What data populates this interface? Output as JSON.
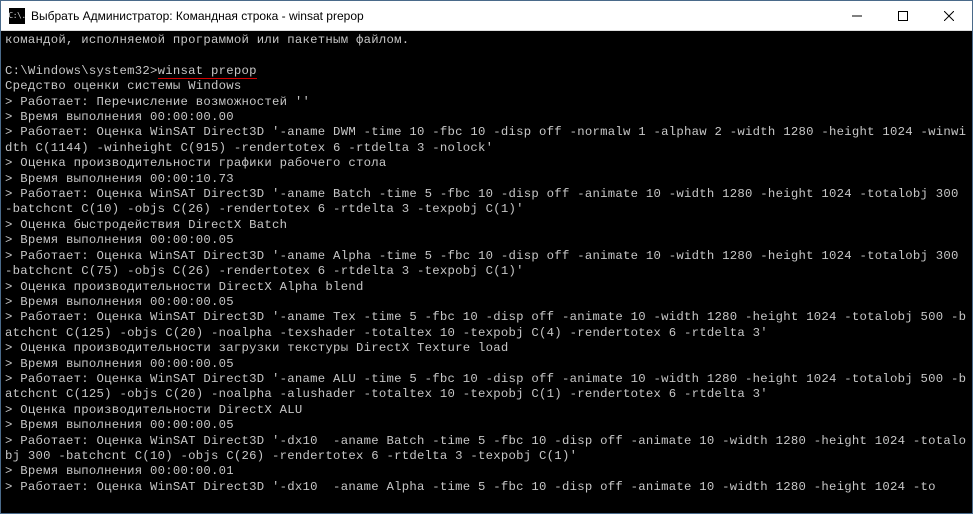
{
  "title": "Выбрать Администратор: Командная строка - winsat  prepop",
  "app_icon_glyph": "C:\\.",
  "prompt_path": "C:\\Windows\\system32>",
  "command": "winsat prepop",
  "lines_before": [
    "командой, исполняемой программой или пакетным файлом.",
    ""
  ],
  "lines_after": [
    "Средство оценки системы Windows",
    "> Работает: Перечисление возможностей ''",
    "> Время выполнения 00:00:00.00",
    "> Работает: Оценка WinSAT Direct3D '-aname DWM -time 10 -fbc 10 -disp off -normalw 1 -alphaw 2 -width 1280 -height 1024 -winwidth C(1144) -winheight C(915) -rendertotex 6 -rtdelta 3 -nolock'",
    "> Оценка производительности графики рабочего стола",
    "> Время выполнения 00:00:10.73",
    "> Работает: Оценка WinSAT Direct3D '-aname Batch -time 5 -fbc 10 -disp off -animate 10 -width 1280 -height 1024 -totalobj 300 -batchcnt C(10) -objs C(26) -rendertotex 6 -rtdelta 3 -texpobj C(1)'",
    "> Оценка быстродействия DirectX Batch",
    "> Время выполнения 00:00:00.05",
    "> Работает: Оценка WinSAT Direct3D '-aname Alpha -time 5 -fbc 10 -disp off -animate 10 -width 1280 -height 1024 -totalobj 300 -batchcnt C(75) -objs C(26) -rendertotex 6 -rtdelta 3 -texpobj C(1)'",
    "> Оценка производительности DirectX Alpha blend",
    "> Время выполнения 00:00:00.05",
    "> Работает: Оценка WinSAT Direct3D '-aname Tex -time 5 -fbc 10 -disp off -animate 10 -width 1280 -height 1024 -totalobj 500 -batchcnt C(125) -objs C(20) -noalpha -texshader -totaltex 10 -texpobj C(4) -rendertotex 6 -rtdelta 3'",
    "> Оценка производительности загрузки текстуры DirectX Texture load",
    "> Время выполнения 00:00:00.05",
    "> Работает: Оценка WinSAT Direct3D '-aname ALU -time 5 -fbc 10 -disp off -animate 10 -width 1280 -height 1024 -totalobj 500 -batchcnt C(125) -objs C(20) -noalpha -alushader -totaltex 10 -texpobj C(1) -rendertotex 6 -rtdelta 3'",
    "> Оценка производительности DirectX ALU",
    "> Время выполнения 00:00:00.05",
    "> Работает: Оценка WinSAT Direct3D '-dx10  -aname Batch -time 5 -fbc 10 -disp off -animate 10 -width 1280 -height 1024 -totalobj 300 -batchcnt C(10) -objs C(26) -rendertotex 6 -rtdelta 3 -texpobj C(1)'",
    "> Время выполнения 00:00:00.01",
    "> Работает: Оценка WinSAT Direct3D '-dx10  -aname Alpha -time 5 -fbc 10 -disp off -animate 10 -width 1280 -height 1024 -to"
  ]
}
